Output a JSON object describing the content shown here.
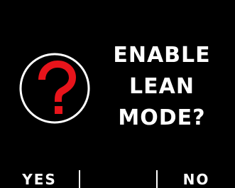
{
  "dialog": {
    "icon": "question-mark-icon",
    "message_lines": [
      "ENABLE",
      "LEAN",
      "MODE?"
    ]
  },
  "softkeys": {
    "left": "YES",
    "middle": "",
    "right": "NO"
  },
  "colors": {
    "background": "#000000",
    "text": "#ffffff",
    "icon_accent": "#e8141b"
  }
}
